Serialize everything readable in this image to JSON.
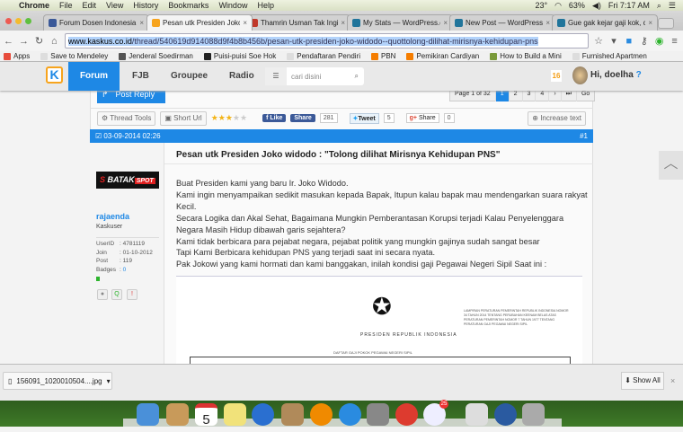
{
  "menubar": {
    "app": "Chrome",
    "items": [
      "File",
      "Edit",
      "View",
      "History",
      "Bookmarks",
      "Window",
      "Help"
    ],
    "weather": "23°",
    "battery": "63%",
    "clock": "Fri 7:17 AM"
  },
  "tabs": [
    {
      "title": "Forum Dosen Indonesia",
      "color": "#3b5998"
    },
    {
      "title": "Pesan utk Presiden Joko w",
      "color": "#f7a41d",
      "active": true
    },
    {
      "title": "Thamrin Usman Tak Ingin",
      "color": "#c0392b"
    },
    {
      "title": "My Stats — WordPress.co",
      "color": "#21759b"
    },
    {
      "title": "New Post — WordPress.co",
      "color": "#21759b"
    },
    {
      "title": "Gue gak kejar gaji kok, c",
      "color": "#21759b"
    }
  ],
  "address": {
    "host": "www.kaskus.co.id",
    "path": "/thread/540619d914088d9f4b8b456b/pesan-utk-presiden-joko-widodo--quottolong-dilihat-mirisnya-kehidupan-pns"
  },
  "bookmarks": [
    {
      "label": "Apps",
      "color": "#e74c3c"
    },
    {
      "label": "Save to Mendeley",
      "color": "#ddd"
    },
    {
      "label": "Jenderal Soedirman",
      "color": "#555"
    },
    {
      "label": "Puisi-puisi Soe Hok",
      "color": "#222"
    },
    {
      "label": "Pendaftaran Pendiri",
      "color": "#ddd"
    },
    {
      "label": "PBN",
      "color": "#f57d00"
    },
    {
      "label": "Pemikiran Cardiyan",
      "color": "#f57d00"
    },
    {
      "label": "How to Build a Mini",
      "color": "#7a9a3a"
    },
    {
      "label": "Furnished Apartmen",
      "color": "#ddd"
    }
  ],
  "kaskus": {
    "logo": "K",
    "nav": [
      "Forum",
      "FJB",
      "Groupee",
      "Radio"
    ],
    "search_placeholder": "cari disini",
    "notifications": "16",
    "greeting": "Hi, doelha"
  },
  "thread": {
    "post_reply": "Post Reply",
    "pager": {
      "label": "Page 1 of 32",
      "pages": [
        "1",
        "2",
        "3",
        "4"
      ],
      "next": "›",
      "last": "⏭",
      "go": "Go"
    },
    "tools": {
      "thread_tools": "Thread Tools",
      "short_url": "Short Url",
      "rating": 3,
      "like": "Like",
      "share": "Share",
      "fb_count": "281",
      "tweet": "Tweet",
      "tweet_count": "5",
      "gplus": "Share",
      "gplus_count": "0",
      "increase": "Increase text"
    },
    "post": {
      "date": "03-09-2014 02:26",
      "number": "#1",
      "user": {
        "badge": "BATAKSPOT",
        "name": "rajaenda",
        "rank": "Kaskuser",
        "userid": "4781119",
        "join": "01-10-2012",
        "post": "119",
        "badges": "0"
      },
      "title": "Pesan utk Presiden Joko widodo : \"Tolong dilihat Mirisnya Kehidupan PNS\"",
      "lines": [
        "Buat Presiden kami yang baru Ir. Joko Widodo.",
        "Kami ingin menyampaikan sedikit masukan kepada Bapak, Itupun kalau bapak mau mendengarkan suara rakyat Kecil.",
        "Secara Logika dan Akal Sehat, Bagaimana Mungkin Pemberantasan Korupsi terjadi Kalau Penyelenggara Negara Masih Hidup dibawah garis sejahtera?",
        "Kami tidak berbicara para pejabat negara, pejabat politik yang mungkin gajinya sudah sangat besar",
        "Tapi Kami Berbicara kehidupan PNS yang terjadi saat ini secara nyata.",
        "Pak Jokowi yang kami hormati dan kami banggakan, inilah kondisi gaji Pegawai Negeri Sipil Saat ini :"
      ],
      "image": {
        "header": "PRESIDEN REPUBLIK INDONESIA",
        "title": "DAFTAR GAJI POKOK PEGAWAI NEGERI SIPIL",
        "ref": "LAMPIRAN PERATURAN PEMERINTAH REPUBLIK INDONESIA NOMOR 34 TAHUN 2014 TENTANG PERUBAHAN KEENAM BELAS ATAS PERATURAN PEMERINTAH NOMOR 7 TAHUN 1977 TENTANG PERATURAN GAJI PEGAWAI NEGERI SIPIL"
      }
    }
  },
  "downloads": {
    "file": "156091_1020010504....jpg",
    "show_all": "Show All"
  },
  "dock": [
    {
      "app": "Finder",
      "color": "#4a90d9"
    },
    {
      "app": "Contacts",
      "color": "#c89a5a"
    },
    {
      "app": "Calendar",
      "color": "#fff"
    },
    {
      "app": "Stickies",
      "color": "#f1e27a"
    },
    {
      "app": "iTunes",
      "color": "#2a6fd0"
    },
    {
      "app": "Archive",
      "color": "#b08a5a"
    },
    {
      "app": "iBooks",
      "color": "#f08a00"
    },
    {
      "app": "App Store",
      "color": "#2a8be0"
    },
    {
      "app": "System Preferences",
      "color": "#888"
    },
    {
      "app": "Chrome",
      "color": "#dd3b2f"
    },
    {
      "app": "Weather",
      "color": "#eef"
    },
    {
      "app": "Preview",
      "color": "#ddd"
    },
    {
      "app": "1Password",
      "color": "#2a5aa0"
    },
    {
      "app": "Trash",
      "color": "#aaa"
    }
  ],
  "dock_calendar_day": "5",
  "dock_weather_badge": "25"
}
